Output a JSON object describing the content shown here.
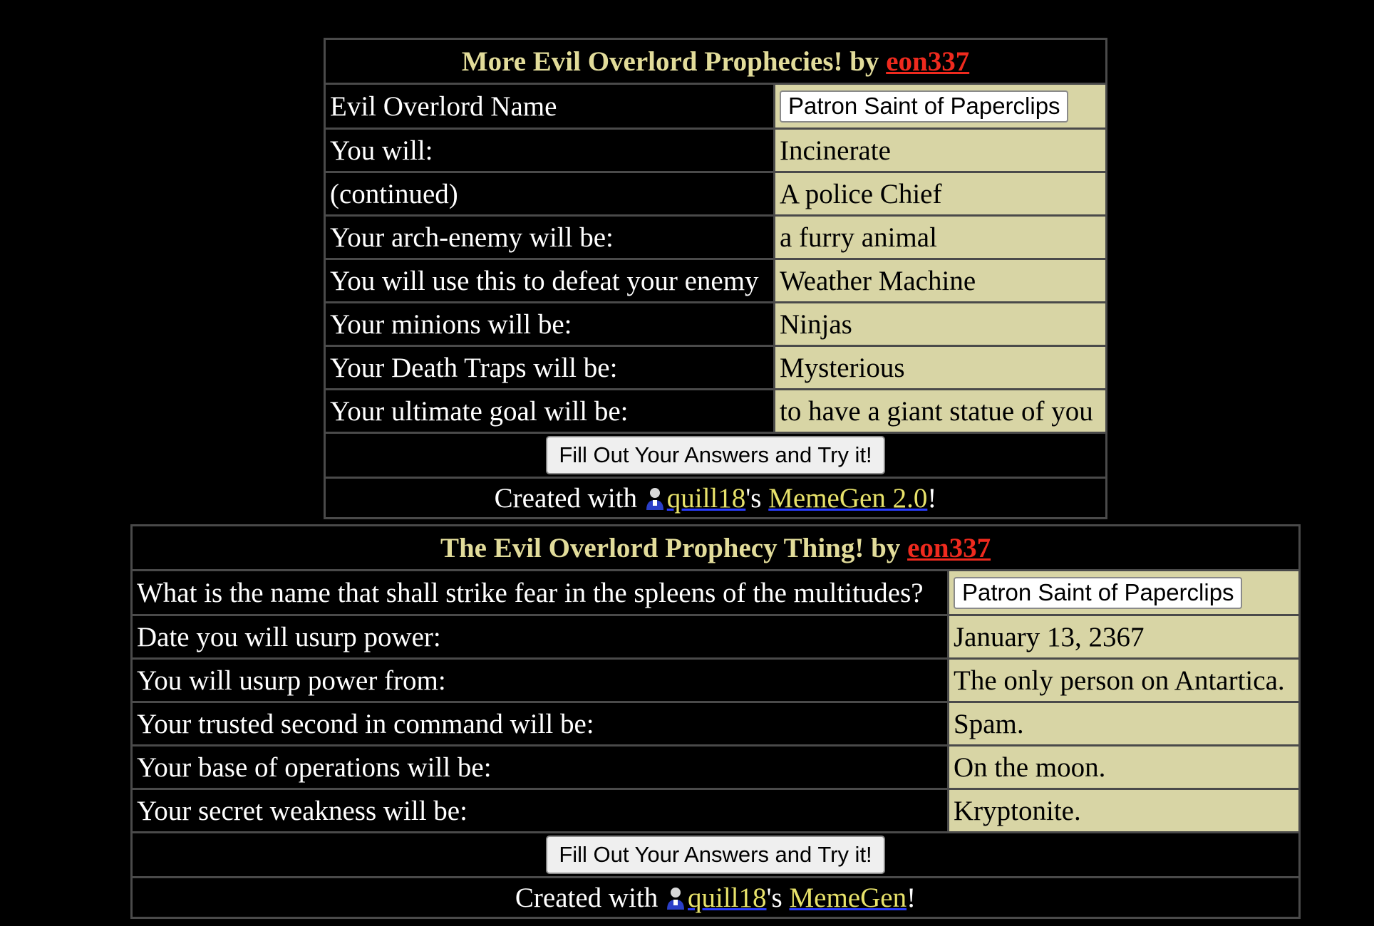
{
  "meme1": {
    "title_prefix": "More Evil Overlord Prophecies! by ",
    "author": "eon337",
    "rows": [
      {
        "label": "Evil Overlord Name",
        "input_value": "Patron Saint of Paperclips"
      },
      {
        "label": "You will:",
        "value": "Incinerate"
      },
      {
        "label": "(continued)",
        "value": "A police Chief"
      },
      {
        "label": "Your arch-enemy will be:",
        "value": "a furry animal"
      },
      {
        "label": "You will use this to defeat your enemy",
        "value": "Weather Machine"
      },
      {
        "label": "Your minions will be:",
        "value": "Ninjas"
      },
      {
        "label": "Your Death Traps will be:",
        "value": "Mysterious"
      },
      {
        "label": "Your ultimate goal will be:",
        "value": "to have a giant statue of you"
      }
    ],
    "button_label": "Fill Out Your Answers and Try it!",
    "credit": {
      "prefix": "Created with ",
      "user": "quill18",
      "possessive": "'s ",
      "tool": "MemeGen 2.0",
      "suffix": "!"
    }
  },
  "meme2": {
    "title_prefix": "The Evil Overlord Prophecy Thing! by ",
    "author": "eon337",
    "rows": [
      {
        "label": "What is the name that shall strike fear in the spleens of the multitudes?",
        "input_value": "Patron Saint of Paperclips"
      },
      {
        "label": "Date you will usurp power:",
        "value": "January 13, 2367"
      },
      {
        "label": "You will usurp power from:",
        "value": "The only person on Antartica."
      },
      {
        "label": "Your trusted second in command will be:",
        "value": "Spam."
      },
      {
        "label": "Your base of operations will be:",
        "value": "On the moon."
      },
      {
        "label": "Your secret weakness will be:",
        "value": "Kryptonite."
      }
    ],
    "button_label": "Fill Out Your Answers and Try it!",
    "credit": {
      "prefix": "Created with ",
      "user": "quill18",
      "possessive": "'s ",
      "tool": "MemeGen",
      "suffix": "!"
    }
  },
  "colors": {
    "background": "#000000",
    "title_text": "#e2dc9a",
    "value_cell": "#d8d5a5",
    "author_link": "#ef2a1e",
    "border": "#4a4a4a"
  }
}
